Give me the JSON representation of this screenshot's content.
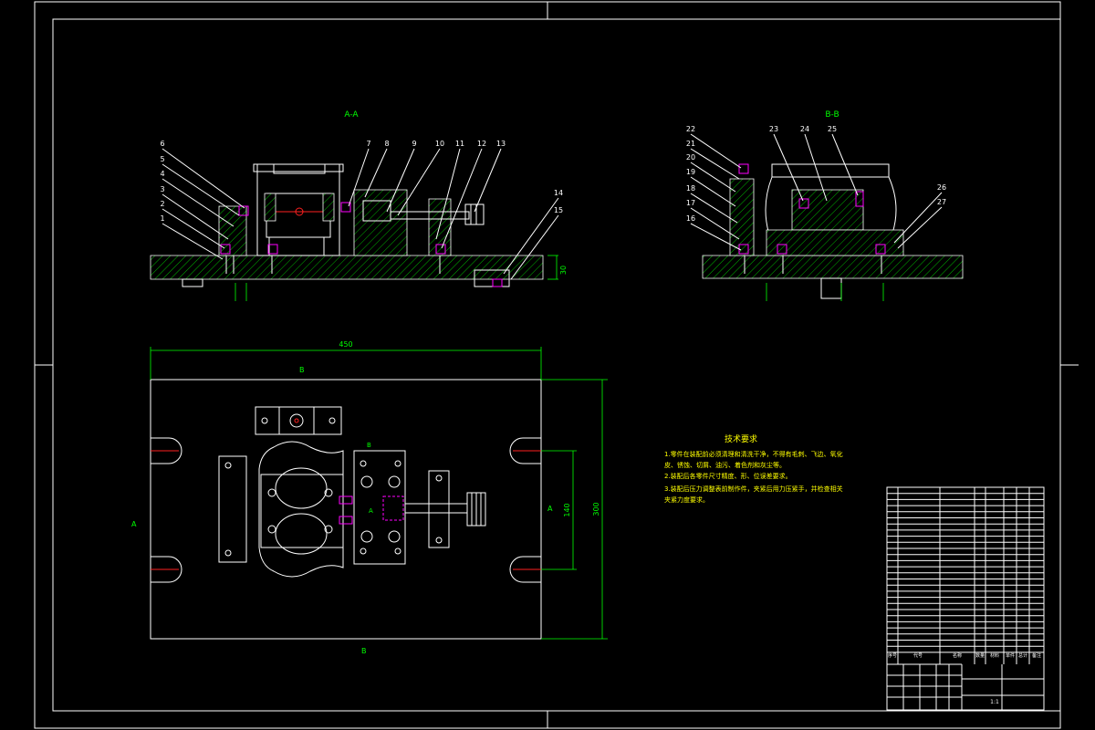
{
  "views": {
    "section_aa": "A-A",
    "section_bb": "B-B",
    "mark_a_left": "A",
    "mark_a_right": "A",
    "mark_b_top": "B",
    "mark_b_bottom": "B",
    "mark_b_part": "B",
    "mark_a_part": "A"
  },
  "callouts_aa": [
    "6",
    "5",
    "4",
    "3",
    "2",
    "1",
    "7",
    "8",
    "9",
    "10",
    "11",
    "12",
    "13",
    "14",
    "15"
  ],
  "callouts_bb": [
    "22",
    "21",
    "20",
    "19",
    "18",
    "17",
    "16",
    "23",
    "24",
    "25",
    "26",
    "27"
  ],
  "dimensions": {
    "overall_length": "450",
    "overall_width": "300",
    "slot_spacing": "140",
    "base_thickness": "30"
  },
  "tech_requirements": {
    "title": "技术要求",
    "lines": [
      "1.零件在装配前必须清理和清洗干净，不得有毛刺、飞边、氧化",
      "皮、锈蚀、切屑、油污、着色剂和灰尘等。",
      "2.装配后各零件尺寸精度、形、位误差要求。",
      "3.装配后压力调整表前制作件，夹紧后用力压紧手，并检查相关",
      "夹紧力度要求。"
    ]
  },
  "title_block": {
    "header_labels": [
      "序号",
      "代号",
      "名称",
      "数量",
      "材料",
      "单件",
      "总计",
      "备注"
    ],
    "scale_label": "1:1"
  }
}
